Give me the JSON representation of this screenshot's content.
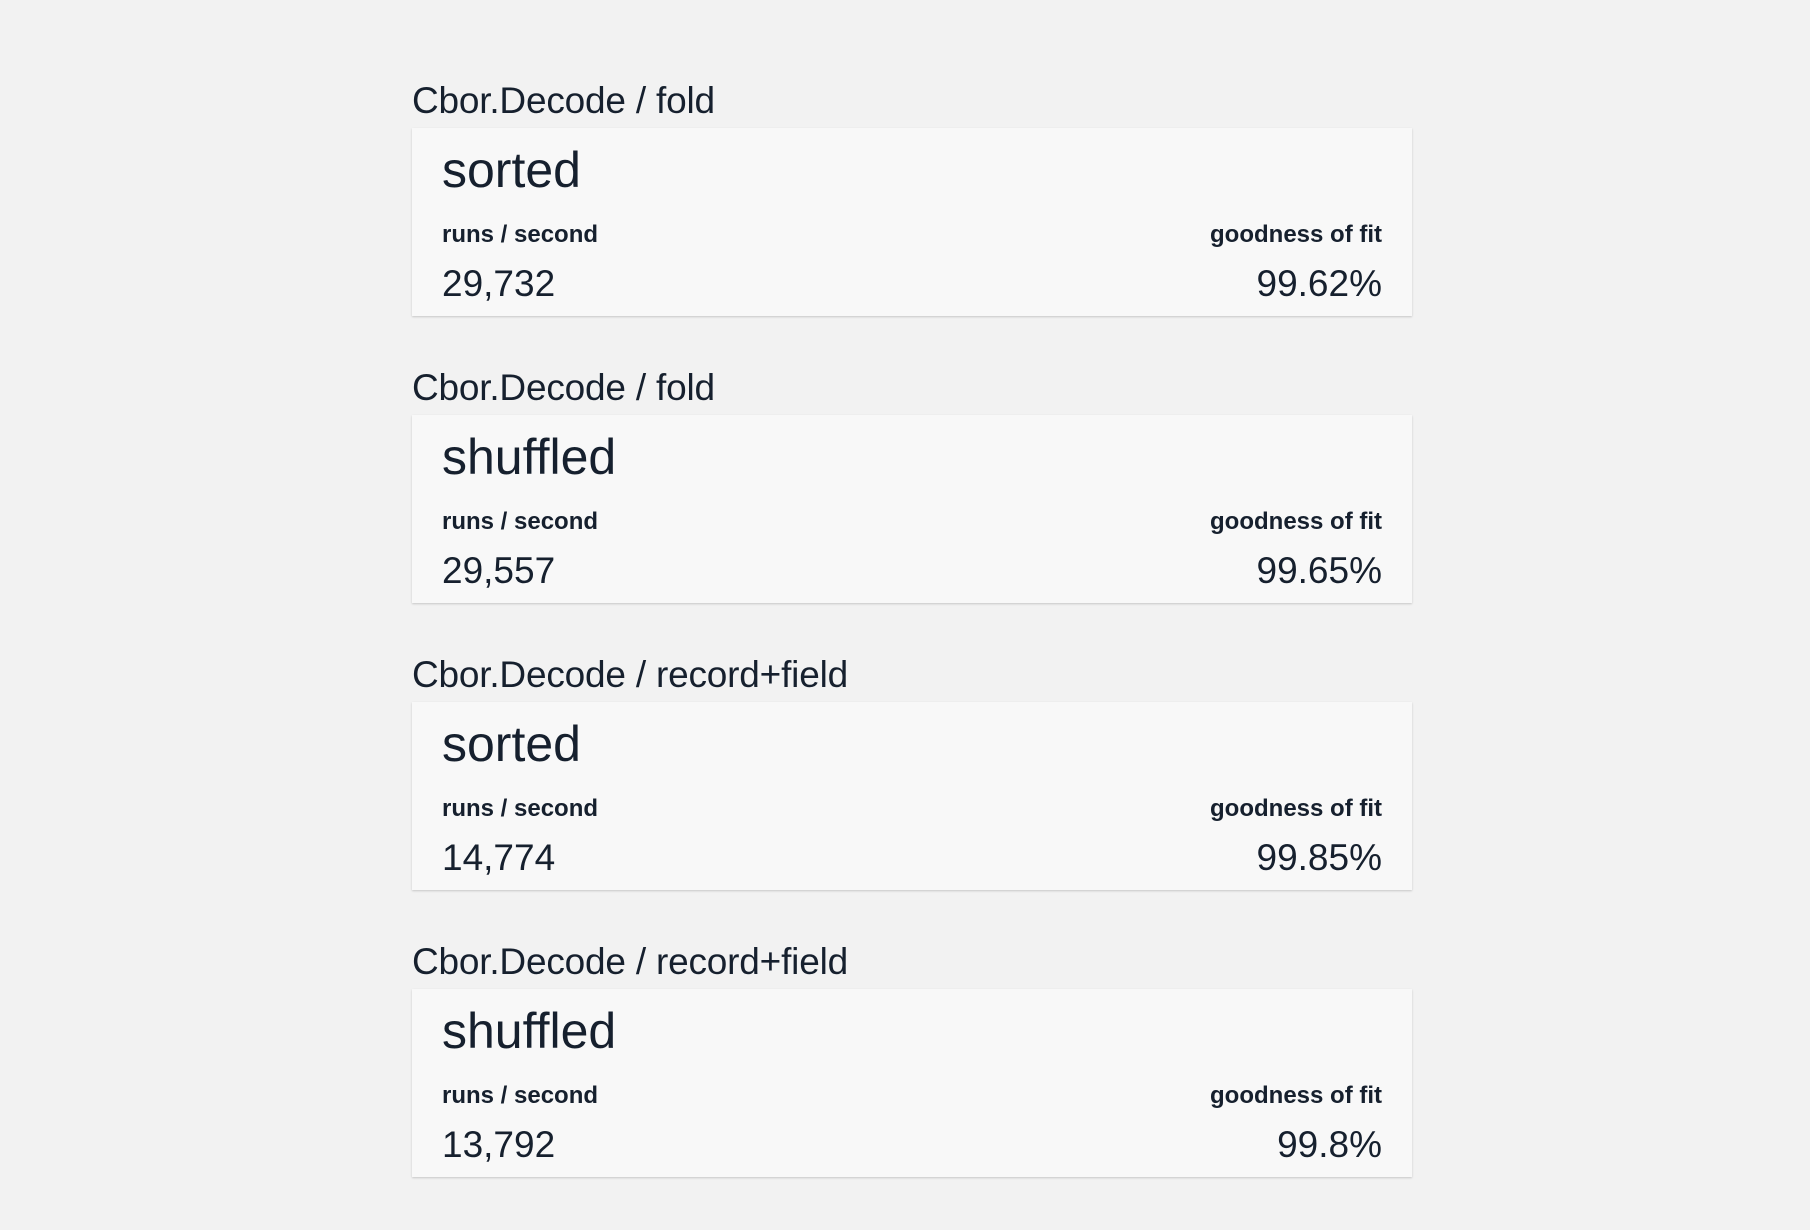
{
  "benchmarks": [
    {
      "title": "Cbor.Decode / fold",
      "name": "sorted",
      "runs_label": "runs / second",
      "runs_value": "29,732",
      "fit_label": "goodness of fit",
      "fit_value": "99.62%"
    },
    {
      "title": "Cbor.Decode / fold",
      "name": "shuffled",
      "runs_label": "runs / second",
      "runs_value": "29,557",
      "fit_label": "goodness of fit",
      "fit_value": "99.65%"
    },
    {
      "title": "Cbor.Decode / record+field",
      "name": "sorted",
      "runs_label": "runs / second",
      "runs_value": "14,774",
      "fit_label": "goodness of fit",
      "fit_value": "99.85%"
    },
    {
      "title": "Cbor.Decode / record+field",
      "name": "shuffled",
      "runs_label": "runs / second",
      "runs_value": "13,792",
      "fit_label": "goodness of fit",
      "fit_value": "99.8%"
    }
  ]
}
